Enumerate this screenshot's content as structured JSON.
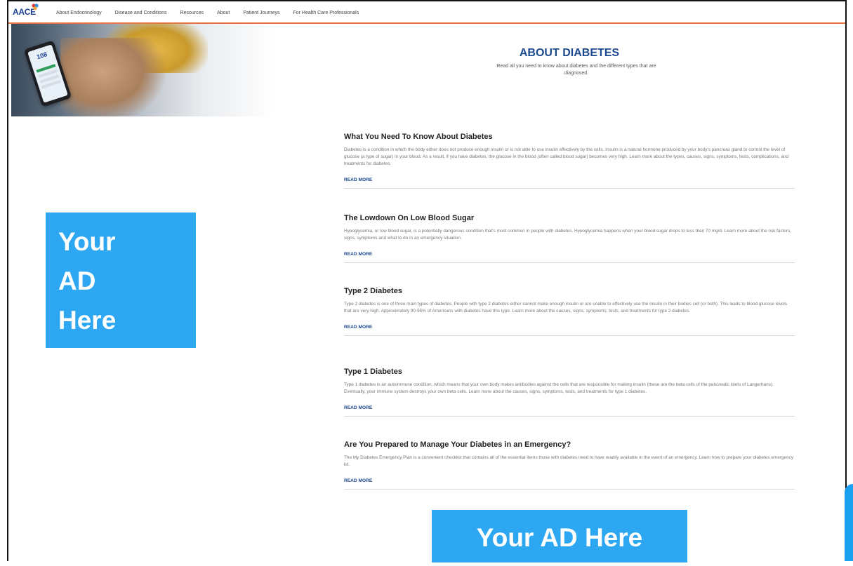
{
  "nav": {
    "logo": "AACE",
    "links": [
      "About Endocrinology",
      "Disease and Conditions",
      "Resources",
      "About",
      "Patient Journeys",
      "For Health Care Professionals"
    ]
  },
  "hero": {
    "title": "ABOUT DIABETES",
    "subtitle": "Read all you need to know about diabetes and the different types that are diagnosed.",
    "phone_reading": "108"
  },
  "articles": [
    {
      "title": "What You Need To Know About Diabetes",
      "body": "Diabetes is a condition in which the body either does not produce enough insulin or is not able to use insulin effectively by the cells. Insulin is a natural hormone produced by your body's pancreas gland to control the level of glucose (a type of sugar) in your blood. As a result, if you have diabetes, the glucose in the blood (often called blood sugar) becomes very high. Learn more about the types, causes, signs, symptoms, tests, complications, and treatments for diabetes.",
      "more": "READ MORE"
    },
    {
      "title": "The Lowdown On Low Blood Sugar",
      "body": "Hypoglycemia, or low blood sugar, is a potentially dangerous condition that's most common in people with diabetes. Hypoglycemia happens when your blood sugar drops to less than 70 mg/d. Learn more about the risk factors, signs, symptoms and what to do in an emergency situation.",
      "more": "READ MORE"
    },
    {
      "title": "Type 2 Diabetes",
      "body": "Type 2 diabetes is one of three main types of diabetes. People with type 2 diabetes either cannot make enough insulin or are unable to effectively use the insulin in their bodies cell (or both). This leads to blood glucose levels that are very high. Approximately 90-95% of Americans with diabetes have this type. Learn more about the causes, signs, symptoms, tests, and treatments for type 2 diabetes.",
      "more": "READ MORE"
    },
    {
      "title": "Type 1 Diabetes",
      "body": "Type 1 diabetes is an autoimmune condition, which means that your own body makes antibodies against the cells that are responsible for making insulin (these are the beta cells of the pancreatic islets of Langerhans). Eventually, your immune system destroys your own beta cells. Learn more about the causes, signs, symptoms, tests, and treatments for type 1 diabetes.",
      "more": "READ MORE"
    },
    {
      "title": "Are You Prepared to Manage Your Diabetes in an Emergency?",
      "body": "The My Diabetes Emergency Plan is a convenient checklist that contains all of the essential items those with diabetes need to have readily available in the event of an emergency. Learn how to prepare your diabetes emergency kit.",
      "more": "READ MORE"
    }
  ],
  "ads": {
    "left_lines": [
      "Your",
      "AD",
      "Here"
    ],
    "bottom": "Your AD Here"
  },
  "colors": {
    "accent": "#1c4a8f",
    "nav_rule": "#e8733a",
    "ad_blue": "#2ea7f2"
  }
}
